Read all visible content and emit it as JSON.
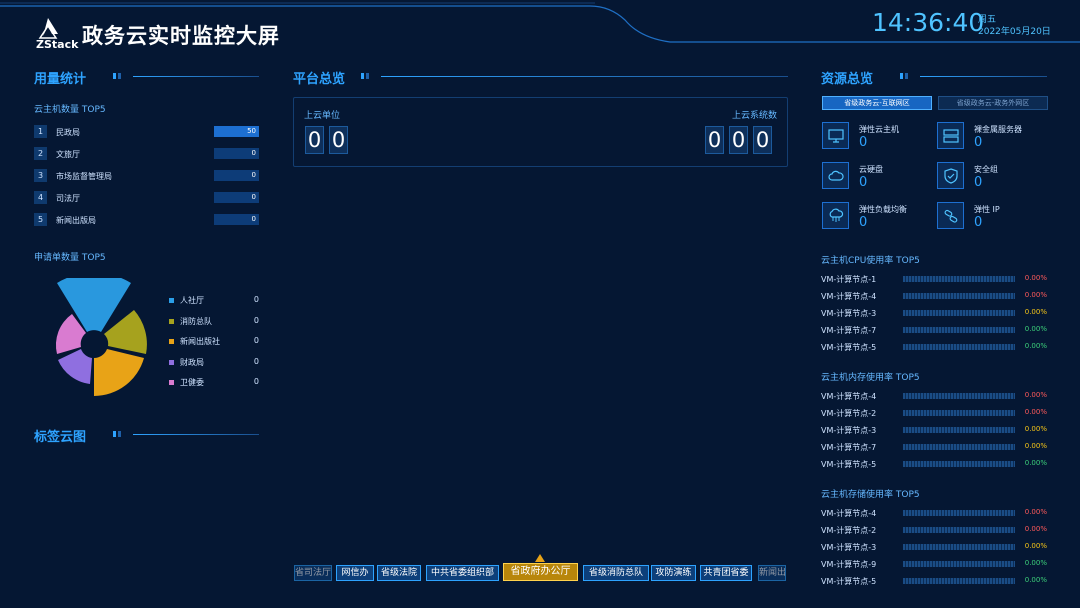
{
  "header": {
    "logo_text": "ZStack",
    "title": "政务云实时监控大屏",
    "time": "14:36:40",
    "weekday": "周五",
    "date": "2022年05月20日"
  },
  "usage": {
    "title": "用量统计",
    "vm_top5": {
      "title": "云主机数量 TOP5",
      "items": [
        {
          "rank": "1",
          "name": "民政局",
          "value": "50",
          "fill": 1.0
        },
        {
          "rank": "2",
          "name": "文旅厅",
          "value": "0",
          "fill": 0
        },
        {
          "rank": "3",
          "name": "市场监督管理局",
          "value": "0",
          "fill": 0
        },
        {
          "rank": "4",
          "name": "司法厅",
          "value": "0",
          "fill": 0
        },
        {
          "rank": "5",
          "name": "新闻出版局",
          "value": "0",
          "fill": 0
        }
      ]
    },
    "apply_top5": {
      "title": "申请单数量 TOP5",
      "items": [
        {
          "name": "人社厅",
          "value": "0",
          "color": "#2b9fe8"
        },
        {
          "name": "消防总队",
          "value": "0",
          "color": "#a6a21e"
        },
        {
          "name": "新闻出版社",
          "value": "0",
          "color": "#e8a317"
        },
        {
          "name": "财政局",
          "value": "0",
          "color": "#8f6fe0"
        },
        {
          "name": "卫健委",
          "value": "0",
          "color": "#d97bd0"
        }
      ]
    },
    "tag_cloud_title": "标签云图"
  },
  "platform": {
    "title": "平台总览",
    "units_label": "上云单位",
    "units_digits": [
      "0",
      "0"
    ],
    "systems_label": "上云系统数",
    "systems_digits": [
      "0",
      "0",
      "0"
    ]
  },
  "tags": {
    "items": [
      "省司法厅",
      "网信办",
      "省级法院",
      "中共省委组织部",
      "省政府办公厅",
      "省级消防总队",
      "攻防演练",
      "共青团省委",
      "新闻出版"
    ],
    "active": "省政府办公厅"
  },
  "resources": {
    "title": "资源总览",
    "tabs": [
      {
        "label": "省级政务云-互联网区",
        "active": true
      },
      {
        "label": "省级政务云-政务外网区",
        "active": false
      }
    ],
    "cards": [
      {
        "name": "弹性云主机",
        "value": "0",
        "icon": "monitor-icon"
      },
      {
        "name": "裸金属服务器",
        "value": "0",
        "icon": "server-icon"
      },
      {
        "name": "云硬盘",
        "value": "0",
        "icon": "cloud-icon"
      },
      {
        "name": "安全组",
        "value": "0",
        "icon": "shield-icon"
      },
      {
        "name": "弹性负载均衡",
        "value": "0",
        "icon": "cloud-network-icon"
      },
      {
        "name": "弹性 IP",
        "value": "0",
        "icon": "link-icon"
      }
    ],
    "cpu_top5": {
      "title": "云主机CPU使用率 TOP5",
      "items": [
        {
          "name": "VM-计算节点-1",
          "value": "0.00%",
          "color": "#ff5a5a"
        },
        {
          "name": "VM-计算节点-4",
          "value": "0.00%",
          "color": "#ff5a5a"
        },
        {
          "name": "VM-计算节点-3",
          "value": "0.00%",
          "color": "#f5c518"
        },
        {
          "name": "VM-计算节点-7",
          "value": "0.00%",
          "color": "#3cd07a"
        },
        {
          "name": "VM-计算节点-5",
          "value": "0.00%",
          "color": "#3cd07a"
        }
      ]
    },
    "mem_top5": {
      "title": "云主机内存使用率 TOP5",
      "items": [
        {
          "name": "VM-计算节点-4",
          "value": "0.00%",
          "color": "#ff5a5a"
        },
        {
          "name": "VM-计算节点-2",
          "value": "0.00%",
          "color": "#ff5a5a"
        },
        {
          "name": "VM-计算节点-3",
          "value": "0.00%",
          "color": "#f5c518"
        },
        {
          "name": "VM-计算节点-7",
          "value": "0.00%",
          "color": "#f5c518"
        },
        {
          "name": "VM-计算节点-5",
          "value": "0.00%",
          "color": "#3cd07a"
        }
      ]
    },
    "disk_top5": {
      "title": "云主机存储使用率 TOP5",
      "items": [
        {
          "name": "VM-计算节点-4",
          "value": "0.00%",
          "color": "#ff5a5a"
        },
        {
          "name": "VM-计算节点-2",
          "value": "0.00%",
          "color": "#ff5a5a"
        },
        {
          "name": "VM-计算节点-3",
          "value": "0.00%",
          "color": "#f5c518"
        },
        {
          "name": "VM-计算节点-9",
          "value": "0.00%",
          "color": "#3cd07a"
        },
        {
          "name": "VM-计算节点-5",
          "value": "0.00%",
          "color": "#3cd07a"
        }
      ]
    }
  }
}
